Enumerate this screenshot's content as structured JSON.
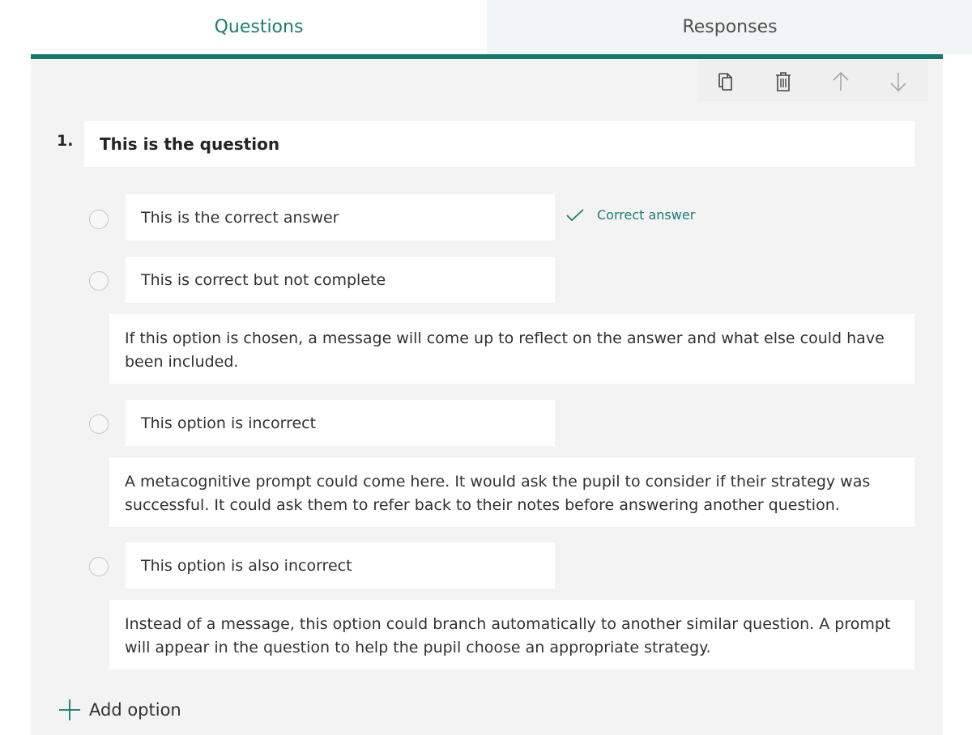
{
  "tabs": {
    "questions": "Questions",
    "responses": "Responses"
  },
  "toolbar": {
    "icons": [
      "copy-icon",
      "delete-icon",
      "arrow-up-icon",
      "arrow-down-icon"
    ]
  },
  "question": {
    "number": "1.",
    "title": "This is the question"
  },
  "options": [
    {
      "label": "This is the correct answer"
    },
    {
      "label": "This is correct but not complete"
    },
    {
      "label": "This option is incorrect"
    },
    {
      "label": "This option is also incorrect"
    }
  ],
  "feedback": [
    "If this option is chosen, a message will come up to reflect on the answer and what else could have been included.",
    "A metacognitive prompt could come here. It would ask the pupil to consider if their strategy was successful. It could ask them to refer back to their notes before answering another question.",
    "Instead of a message, this option could branch automatically to another similar question. A prompt will appear in the question to help the pupil choose an appropriate strategy."
  ],
  "correct_answer_label": "Correct answer",
  "add_option_label": "Add option",
  "colors": {
    "accent": "#137a6d",
    "accent_text": "#1d7d73",
    "panel_bg": "#f3f3f3"
  }
}
